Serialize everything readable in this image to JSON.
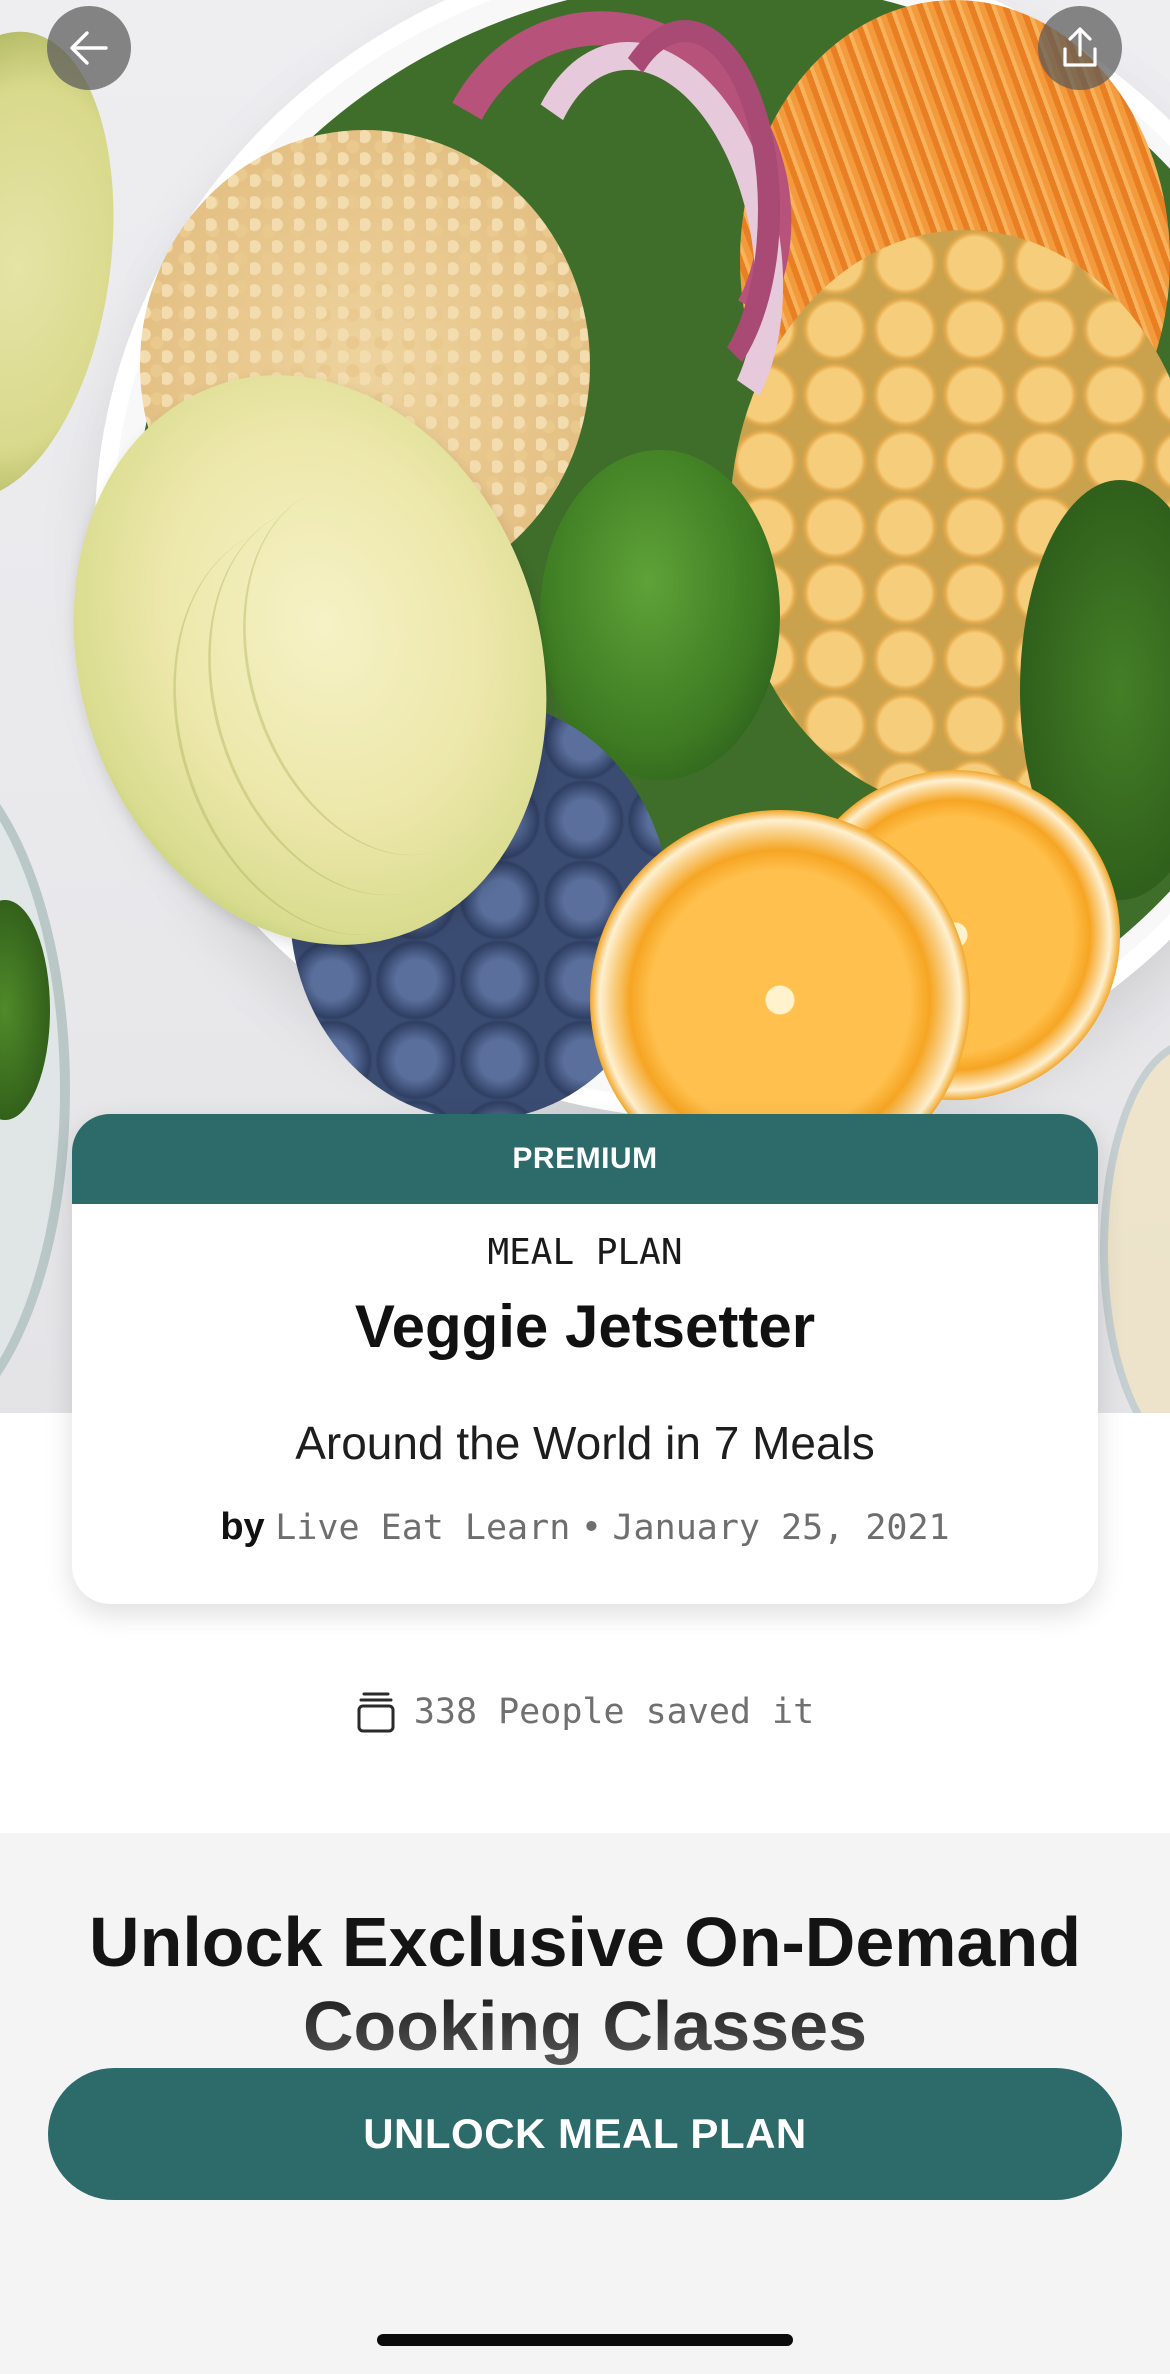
{
  "header": {
    "back_icon": "arrow-left-icon",
    "share_icon": "share-upload-icon"
  },
  "card": {
    "badge": "PREMIUM",
    "kicker": "MEAL PLAN",
    "title": "Veggie Jetsetter",
    "subtitle": "Around the World in 7 Meals",
    "by_label": "by",
    "author": "Live Eat Learn",
    "separator": "•",
    "date": "January 25, 2021"
  },
  "saved": {
    "icon": "saved-stack-icon",
    "text": "338 People saved it"
  },
  "promo": {
    "title": "Unlock Exclusive On-Demand Cooking Classes"
  },
  "cta": {
    "label": "UNLOCK MEAL PLAN"
  },
  "colors": {
    "accent": "#2d6b6a",
    "promo_bg": "#f4f4f5",
    "muted_text": "#6e6e6e"
  }
}
